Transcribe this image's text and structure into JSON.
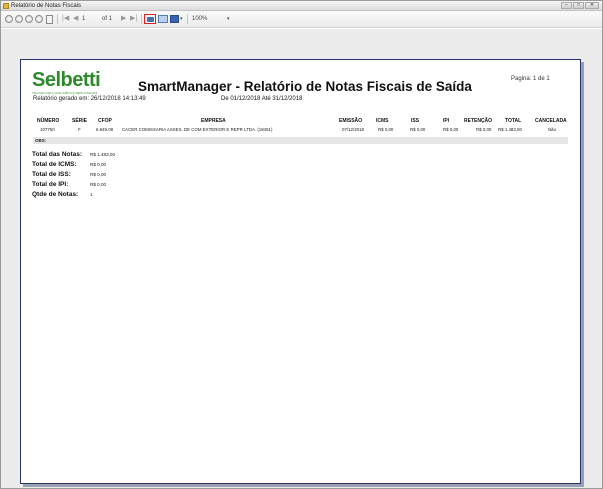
{
  "window": {
    "title": "Relatório de Notas Fiscais",
    "buttons": [
      "–",
      "□",
      "✕"
    ]
  },
  "toolbar": {
    "page_current": "1",
    "page_of": "of 1",
    "zoom": "100%"
  },
  "report": {
    "logo_text": "Selbetti",
    "logo_tagline": "TECNOLOGIA QUE AMPLIA RESULTADOS",
    "title": "SmartManager - Relatório de Notas Fiscais  de Saída",
    "page_label": "Pagina:    1 de 1",
    "generated": "Relatório gerado em:  26/12/2018 14:13:49",
    "period": "De 01/12/2018 Até 31/12/2018",
    "columns": [
      "NÚMERO",
      "SÉRIE",
      "CFOP",
      "EMPRESA",
      "EMISSÃO",
      "ICMS",
      "ISS",
      "IPI",
      "RETENÇÃO",
      "TOTAL",
      "CANCELADA"
    ],
    "rows": [
      [
        "107750",
        "F",
        "6.949.08",
        "CACER COMISSARIA ASSES. DE COM EXTERIOR E REPR LTDA. (18451)",
        "07/12/2018",
        "R$ 0,00",
        "R$ 0,00",
        "R$ 0,00",
        "R$ 0,00",
        "R$ 1.483,00",
        "Não"
      ]
    ],
    "obs_label": "OBS:",
    "totals": [
      {
        "label": "Total das Notas:",
        "value": "R$ 1.483,00"
      },
      {
        "label": "Total de ICMS:",
        "value": "R$ 0,00"
      },
      {
        "label": "Total de ISS:",
        "value": "R$ 0,00"
      },
      {
        "label": "Total de IPI:",
        "value": "R$ 0,00"
      },
      {
        "label": "Qtde de Notas:",
        "value": "1"
      }
    ]
  },
  "colors": {
    "logo_green": "#2d8a2b",
    "page_border": "#27346e",
    "highlight_red": "#e02020"
  }
}
